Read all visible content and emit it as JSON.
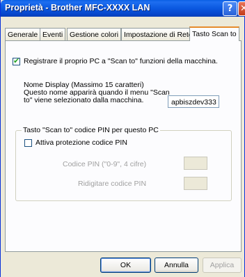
{
  "window": {
    "title": "Proprietà - Brother MFC-XXXX LAN",
    "help_glyph": "?",
    "close_glyph": "✕"
  },
  "tabs": [
    {
      "label": "Generale"
    },
    {
      "label": "Eventi"
    },
    {
      "label": "Gestione colori"
    },
    {
      "label": "Impostazione di Rete"
    },
    {
      "label": "Tasto Scan to"
    }
  ],
  "scan_to": {
    "register_checkbox_checked": true,
    "register_label": "Registrare il proprio PC a \"Scan to\" funzioni della macchina.",
    "display_name_label_line1": "Nome Display (Massimo 15 caratteri)",
    "display_name_label_line2": "Questo nome apparirà quando il menu \"Scan",
    "display_name_label_line3": "to\" viene selezionato dalla macchina.",
    "display_name_value": "apbiszdev333",
    "pin_group": {
      "legend": "Tasto \"Scan to\" codice PIN per questo PC",
      "protect_checkbox_checked": false,
      "protect_label": "Attiva protezione codice PIN",
      "pin_label": "Codice PIN (\"0-9\", 4 cifre)",
      "pin_value": "",
      "retype_label": "Ridigitare codice PIN",
      "retype_value": ""
    }
  },
  "buttons": {
    "ok": "OK",
    "cancel": "Annulla",
    "apply": "Applica"
  }
}
